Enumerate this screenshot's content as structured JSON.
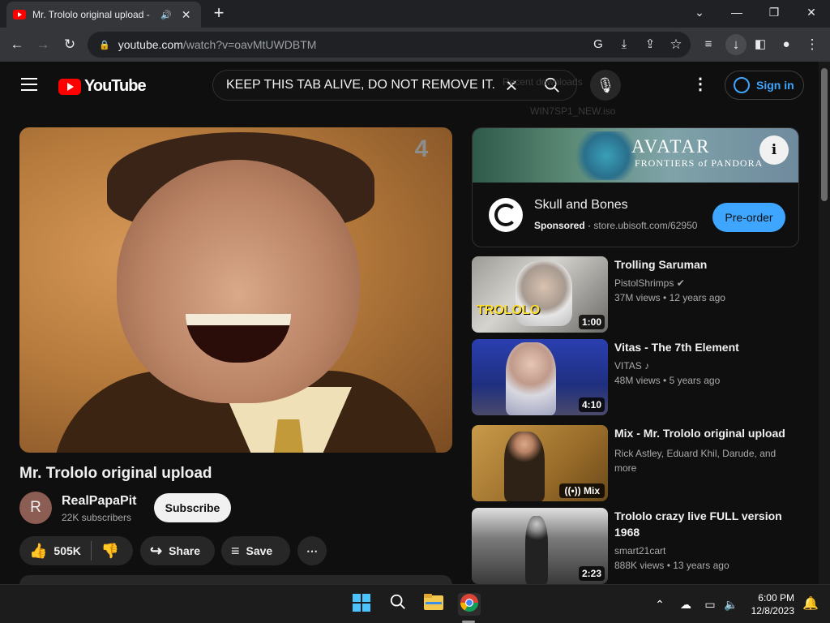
{
  "browser": {
    "tab_title": "Mr. Trololo original upload -",
    "audio_icon": "speaker-icon",
    "url_host": "youtube.com",
    "url_path": "/watch?v=oavMtUWDBTM"
  },
  "masthead": {
    "logo_text": "YouTube",
    "search_query": "KEEP THIS TAB ALIVE,  DO NOT REMOVE IT.",
    "signin_label": "Sign in",
    "ghost_downloads": "Recent downloads",
    "ghost_file": "WIN7SP1_NEW.iso"
  },
  "video": {
    "title": "Mr. Trololo original upload",
    "channel_initial": "R",
    "channel_name": "RealPapaPit",
    "subscribers": "22K subscribers",
    "subscribe_label": "Subscribe",
    "likes": "505K",
    "share_label": "Share",
    "save_label": "Save"
  },
  "ad": {
    "banner_title": "AVATAR",
    "banner_subtitle": "FRONTIERS of PANDORA",
    "name": "Skull and Bones",
    "sponsored": "Sponsored",
    "domain": "store.ubisoft.com/62950",
    "cta": "Pre-order"
  },
  "recommendations": [
    {
      "title": "Trolling Saruman",
      "channel": "PistolShrimps",
      "views": "37M views",
      "age": "12 years ago",
      "duration": "1:00",
      "overlay": "TROLOLO"
    },
    {
      "title": "Vitas - The 7th Element",
      "channel": "VITAS",
      "views": "48M views",
      "age": "5 years ago",
      "duration": "4:10"
    },
    {
      "title": "Mix - Mr. Trololo original upload",
      "channel": "Rick Astley, Eduard Khil, Darude, and more",
      "duration": "Mix"
    },
    {
      "title": "Trololo crazy live FULL version 1968",
      "channel": "smart21cart",
      "views": "888K views",
      "age": "13 years ago",
      "duration": "2:23"
    }
  ],
  "taskbar": {
    "time": "6:00 PM",
    "date": "12/8/2023"
  }
}
